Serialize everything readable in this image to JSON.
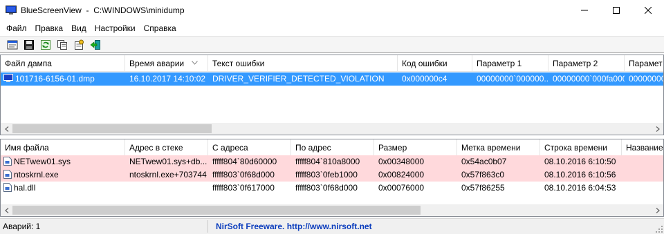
{
  "window": {
    "app_name": "BlueScreenView",
    "path": "C:\\WINDOWS\\minidump",
    "app_icon": "bluescreenview-icon",
    "minimize_icon": "minimize-icon",
    "maximize_icon": "maximize-icon",
    "close_icon": "close-icon"
  },
  "menu": [
    "Файл",
    "Правка",
    "Вид",
    "Настройки",
    "Справка"
  ],
  "toolbar": [
    "html-report-icon",
    "save-icon",
    "refresh-icon",
    "copy-icon",
    "properties-icon",
    "exit-icon"
  ],
  "dump_table": {
    "columns": [
      "Файл дампа",
      "Время аварии",
      "Текст ошибки",
      "Код ошибки",
      "Параметр 1",
      "Параметр 2",
      "Парамет"
    ],
    "sort_column": "Время аварии",
    "rows": [
      {
        "selected": true,
        "cells": [
          "101716-6156-01.dmp",
          "16.10.2017 14:10:02",
          "DRIVER_VERIFIER_DETECTED_VIOLATION",
          "0x000000c4",
          "00000000`000000...",
          "00000000`000fa000",
          "00000000"
        ]
      }
    ]
  },
  "driver_table": {
    "columns": [
      "Имя файла",
      "Адрес в стеке",
      "С адреса",
      "По адрес",
      "Размер",
      "Метка времени",
      "Строка времени",
      "Название"
    ],
    "rows": [
      {
        "highlight": "pink",
        "cells": [
          "NETwew01.sys",
          "NETwew01.sys+db...",
          "fffff804`80d60000",
          "fffff804`810a8000",
          "0x00348000",
          "0x54ac0b07",
          "08.10.2016 6:10:50",
          ""
        ]
      },
      {
        "highlight": "pink",
        "cells": [
          "ntoskrnl.exe",
          "ntoskrnl.exe+703744",
          "fffff803`0f68d000",
          "fffff803`0feb1000",
          "0x00824000",
          "0x57f863c0",
          "08.10.2016 6:10:56",
          ""
        ]
      },
      {
        "highlight": "none",
        "cells": [
          "hal.dll",
          "",
          "fffff803`0f617000",
          "fffff803`0f68d000",
          "0x00076000",
          "0x57f86255",
          "08.10.2016 6:04:53",
          ""
        ]
      }
    ]
  },
  "status": {
    "crash_count": "Аварий: 1",
    "link": "NirSoft Freeware.  http://www.nirsoft.net"
  },
  "colors": {
    "selection": "#3399ff",
    "highlight_pink": "#ffd9dc",
    "link": "#0b3dbd"
  }
}
